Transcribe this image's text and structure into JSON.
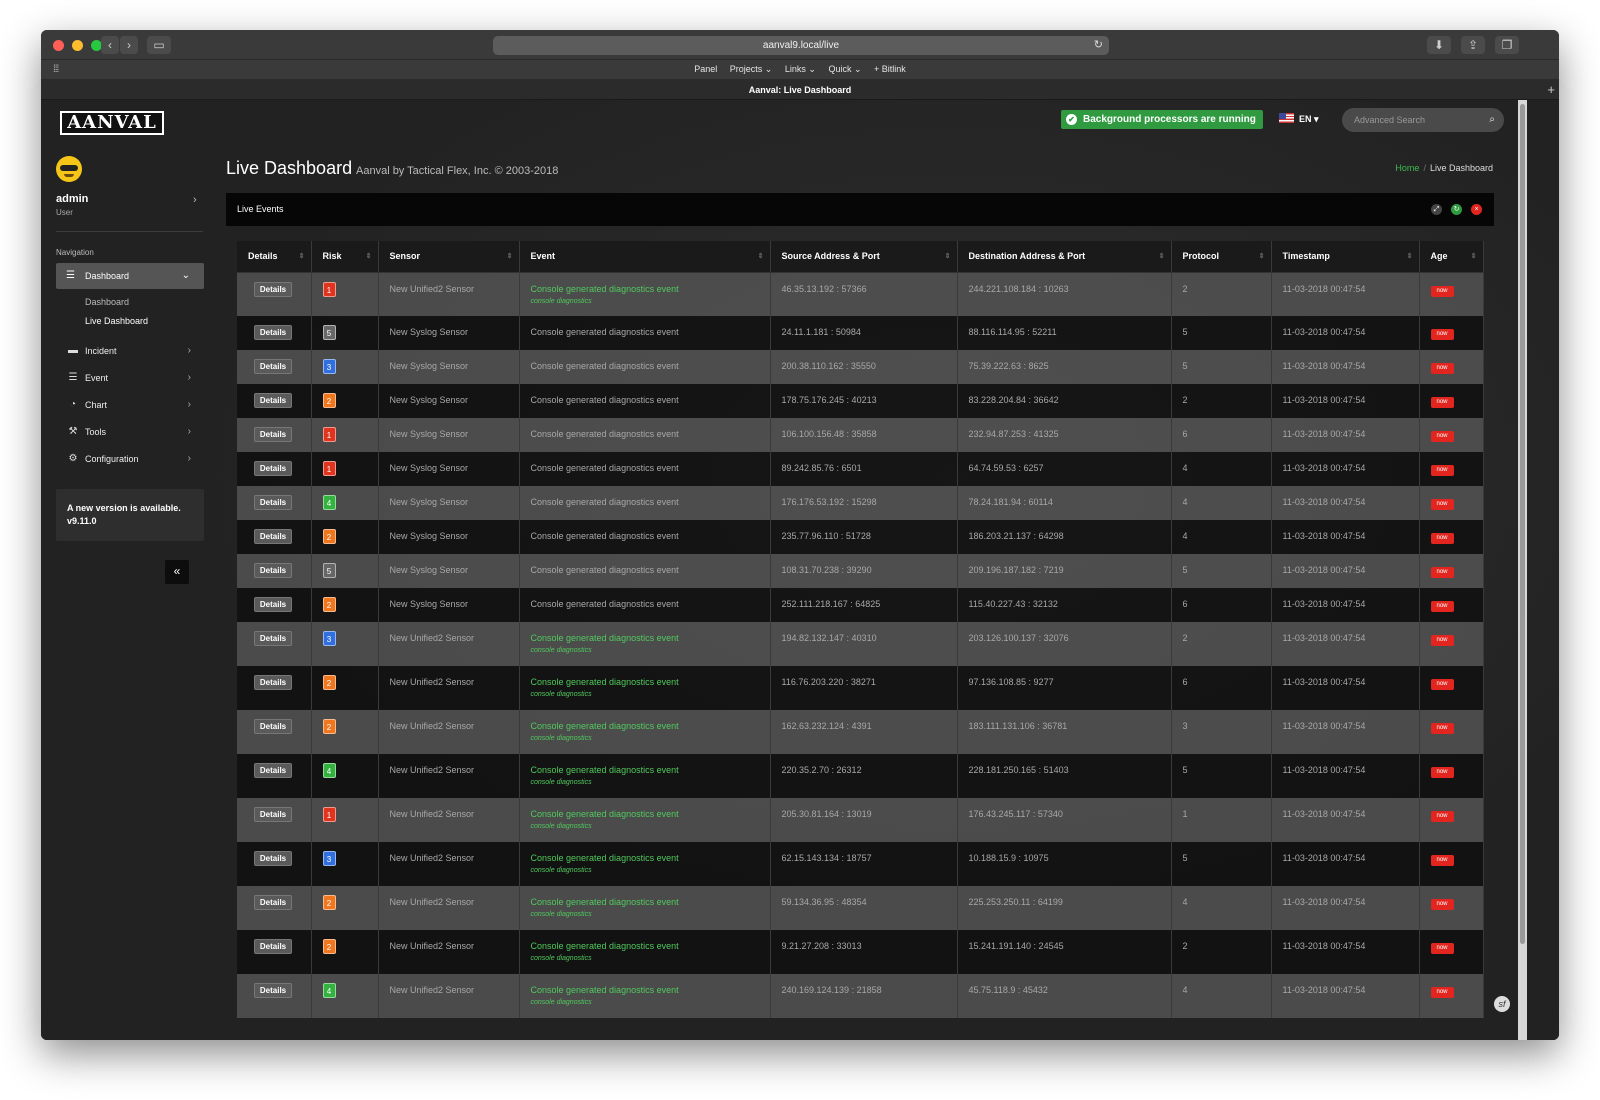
{
  "browser": {
    "url": "aanval9.local/live",
    "tab_title": "Aanval: Live Dashboard",
    "bookmarks": [
      "Panel",
      "Projects ⌄",
      "Links ⌄",
      "Quick ⌄",
      "+ Bitlink"
    ]
  },
  "topbar": {
    "logo": "AANVAL",
    "status": "Background processors are running",
    "language": "EN",
    "search_placeholder": "Advanced Search"
  },
  "sidebar": {
    "user_name": "admin",
    "user_role": "User",
    "nav_heading": "Navigation",
    "active_item": "Dashboard",
    "sub_items": [
      "Dashboard",
      "Live Dashboard"
    ],
    "items": [
      {
        "label": "Incident",
        "icon": "folder-icon"
      },
      {
        "label": "Event",
        "icon": "list-icon"
      },
      {
        "label": "Chart",
        "icon": "pie-chart-icon"
      },
      {
        "label": "Tools",
        "icon": "wrench-icon"
      },
      {
        "label": "Configuration",
        "icon": "gears-icon"
      }
    ],
    "new_version_text": "A new version is available.",
    "new_version": "v9.11.0"
  },
  "page": {
    "title": "Live Dashboard",
    "subtitle": "Aanval by Tactical Flex, Inc. © 2003-2018",
    "breadcrumb_home": "Home",
    "breadcrumb_current": "Live Dashboard",
    "panel_title": "Live Events"
  },
  "table": {
    "columns": [
      "Details",
      "Risk",
      "Sensor",
      "Event",
      "Source Address & Port",
      "Destination Address & Port",
      "Protocol",
      "Timestamp",
      "Age"
    ],
    "details_label": "Details",
    "age_label": "now",
    "risk_colors": {
      "1": "#e0341f",
      "2": "#f0771e",
      "3": "#2f6fe0",
      "4": "#33b23f",
      "5": "#666666"
    },
    "rows": [
      {
        "risk": "1",
        "sensor": "New Unified2 Sensor",
        "event": "Console generated diagnostics event",
        "sub": "console diagnostics",
        "src": "46.35.13.192 : 57366",
        "dst": "244.221.108.184 : 10263",
        "proto": "2",
        "ts": "11-03-2018 00:47:54"
      },
      {
        "risk": "5",
        "sensor": "New Syslog Sensor",
        "event": "Console generated diagnostics event",
        "sub": "",
        "src": "24.11.1.181 : 50984",
        "dst": "88.116.114.95 : 52211",
        "proto": "5",
        "ts": "11-03-2018 00:47:54"
      },
      {
        "risk": "3",
        "sensor": "New Syslog Sensor",
        "event": "Console generated diagnostics event",
        "sub": "",
        "src": "200.38.110.162 : 35550",
        "dst": "75.39.222.63 : 8625",
        "proto": "5",
        "ts": "11-03-2018 00:47:54"
      },
      {
        "risk": "2",
        "sensor": "New Syslog Sensor",
        "event": "Console generated diagnostics event",
        "sub": "",
        "src": "178.75.176.245 : 40213",
        "dst": "83.228.204.84 : 36642",
        "proto": "2",
        "ts": "11-03-2018 00:47:54"
      },
      {
        "risk": "1",
        "sensor": "New Syslog Sensor",
        "event": "Console generated diagnostics event",
        "sub": "",
        "src": "106.100.156.48 : 35858",
        "dst": "232.94.87.253 : 41325",
        "proto": "6",
        "ts": "11-03-2018 00:47:54"
      },
      {
        "risk": "1",
        "sensor": "New Syslog Sensor",
        "event": "Console generated diagnostics event",
        "sub": "",
        "src": "89.242.85.76 : 6501",
        "dst": "64.74.59.53 : 6257",
        "proto": "4",
        "ts": "11-03-2018 00:47:54"
      },
      {
        "risk": "4",
        "sensor": "New Syslog Sensor",
        "event": "Console generated diagnostics event",
        "sub": "",
        "src": "176.176.53.192 : 15298",
        "dst": "78.24.181.94 : 60114",
        "proto": "4",
        "ts": "11-03-2018 00:47:54"
      },
      {
        "risk": "2",
        "sensor": "New Syslog Sensor",
        "event": "Console generated diagnostics event",
        "sub": "",
        "src": "235.77.96.110 : 51728",
        "dst": "186.203.21.137 : 64298",
        "proto": "4",
        "ts": "11-03-2018 00:47:54"
      },
      {
        "risk": "5",
        "sensor": "New Syslog Sensor",
        "event": "Console generated diagnostics event",
        "sub": "",
        "src": "108.31.70.238 : 39290",
        "dst": "209.196.187.182 : 7219",
        "proto": "5",
        "ts": "11-03-2018 00:47:54"
      },
      {
        "risk": "2",
        "sensor": "New Syslog Sensor",
        "event": "Console generated diagnostics event",
        "sub": "",
        "src": "252.111.218.167 : 64825",
        "dst": "115.40.227.43 : 32132",
        "proto": "6",
        "ts": "11-03-2018 00:47:54"
      },
      {
        "risk": "3",
        "sensor": "New Unified2 Sensor",
        "event": "Console generated diagnostics event",
        "sub": "console diagnostics",
        "src": "194.82.132.147 : 40310",
        "dst": "203.126.100.137 : 32076",
        "proto": "2",
        "ts": "11-03-2018 00:47:54"
      },
      {
        "risk": "2",
        "sensor": "New Unified2 Sensor",
        "event": "Console generated diagnostics event",
        "sub": "console diagnostics",
        "src": "116.76.203.220 : 38271",
        "dst": "97.136.108.85 : 9277",
        "proto": "6",
        "ts": "11-03-2018 00:47:54"
      },
      {
        "risk": "2",
        "sensor": "New Unified2 Sensor",
        "event": "Console generated diagnostics event",
        "sub": "console diagnostics",
        "src": "162.63.232.124 : 4391",
        "dst": "183.111.131.106 : 36781",
        "proto": "3",
        "ts": "11-03-2018 00:47:54"
      },
      {
        "risk": "4",
        "sensor": "New Unified2 Sensor",
        "event": "Console generated diagnostics event",
        "sub": "console diagnostics",
        "src": "220.35.2.70 : 26312",
        "dst": "228.181.250.165 : 51403",
        "proto": "5",
        "ts": "11-03-2018 00:47:54"
      },
      {
        "risk": "1",
        "sensor": "New Unified2 Sensor",
        "event": "Console generated diagnostics event",
        "sub": "console diagnostics",
        "src": "205.30.81.164 : 13019",
        "dst": "176.43.245.117 : 57340",
        "proto": "1",
        "ts": "11-03-2018 00:47:54"
      },
      {
        "risk": "3",
        "sensor": "New Unified2 Sensor",
        "event": "Console generated diagnostics event",
        "sub": "console diagnostics",
        "src": "62.15.143.134 : 18757",
        "dst": "10.188.15.9 : 10975",
        "proto": "5",
        "ts": "11-03-2018 00:47:54"
      },
      {
        "risk": "2",
        "sensor": "New Unified2 Sensor",
        "event": "Console generated diagnostics event",
        "sub": "console diagnostics",
        "src": "59.134.36.95 : 48354",
        "dst": "225.253.250.11 : 64199",
        "proto": "4",
        "ts": "11-03-2018 00:47:54"
      },
      {
        "risk": "2",
        "sensor": "New Unified2 Sensor",
        "event": "Console generated diagnostics event",
        "sub": "console diagnostics",
        "src": "9.21.27.208 : 33013",
        "dst": "15.241.191.140 : 24545",
        "proto": "2",
        "ts": "11-03-2018 00:47:54"
      },
      {
        "risk": "4",
        "sensor": "New Unified2 Sensor",
        "event": "Console generated diagnostics event",
        "sub": "console diagnostics",
        "src": "240.169.124.139 : 21858",
        "dst": "45.75.118.9 : 45432",
        "proto": "4",
        "ts": "11-03-2018 00:47:54"
      }
    ]
  }
}
